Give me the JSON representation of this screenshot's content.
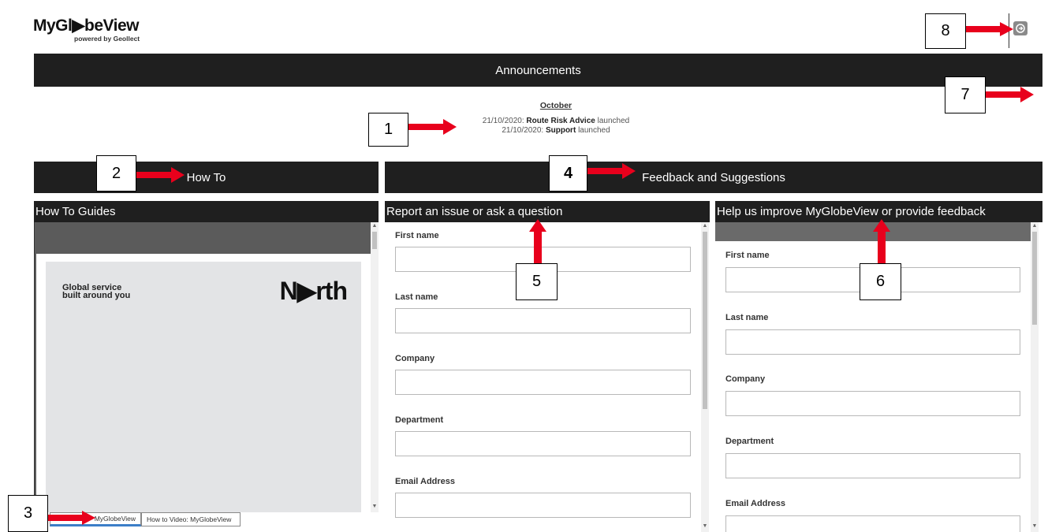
{
  "logo": {
    "main": "MyGl▶beView",
    "sub": "powered by Geollect"
  },
  "announcements": {
    "title": "Announcements",
    "month": "October",
    "items": [
      {
        "date": "21/10/2020:",
        "name": "Route Risk Advice",
        "suffix": "launched"
      },
      {
        "date": "21/10/2020:",
        "name": "Support",
        "suffix": "launched"
      }
    ]
  },
  "sections": {
    "how_to": "How To",
    "feedback": "Feedback and Suggestions"
  },
  "panels": {
    "guides": "How To Guides",
    "report": "Report an issue or ask a question",
    "improve": "Help us improve MyGlobeView or provide feedback"
  },
  "guide_doc": {
    "tagline_1": "Global service",
    "tagline_2": "built around you",
    "brand": "N▶rth"
  },
  "guide_tabs": [
    "MyGlobeView",
    "How to Video: MyGlobeView"
  ],
  "form_fields": [
    "First name",
    "Last name",
    "Company",
    "Department",
    "Email Address"
  ],
  "annotations": [
    "1",
    "2",
    "3",
    "4",
    "5",
    "6",
    "7",
    "8"
  ],
  "colors": {
    "bar": "#1f1f1f",
    "arrow": "#e8001c",
    "tab_accent": "#3c7ec8"
  }
}
